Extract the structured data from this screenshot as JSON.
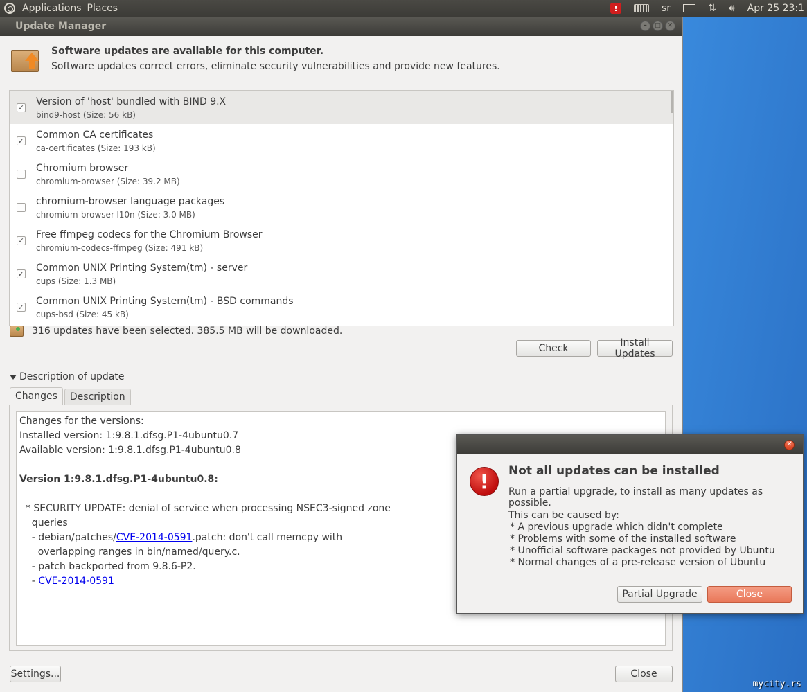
{
  "top_panel": {
    "menus": [
      "Applications",
      "Places"
    ],
    "tray": {
      "alert_icon": "alert-icon",
      "keyboard_layout": "sr",
      "datetime": "Apr 25 23:1"
    }
  },
  "window": {
    "title": "Update Manager",
    "header": {
      "title": "Software updates are available for this computer.",
      "subtitle": "Software updates correct errors, eliminate security vulnerabilities and provide new features."
    },
    "packages": [
      {
        "name": "Version of 'host' bundled with BIND 9.X",
        "detail": "bind9-host (Size: 56 kB)",
        "checked": true,
        "selected": true
      },
      {
        "name": "Common CA certificates",
        "detail": "ca-certificates (Size: 193 kB)",
        "checked": true,
        "selected": false
      },
      {
        "name": "Chromium browser",
        "detail": "chromium-browser (Size: 39.2 MB)",
        "checked": false,
        "selected": false
      },
      {
        "name": "chromium-browser language packages",
        "detail": "chromium-browser-l10n (Size: 3.0 MB)",
        "checked": false,
        "selected": false
      },
      {
        "name": "Free ffmpeg codecs for the Chromium Browser",
        "detail": "chromium-codecs-ffmpeg (Size: 491 kB)",
        "checked": true,
        "selected": false
      },
      {
        "name": "Common UNIX Printing System(tm) - server",
        "detail": "cups (Size: 1.3 MB)",
        "checked": true,
        "selected": false
      },
      {
        "name": "Common UNIX Printing System(tm) - BSD commands",
        "detail": "cups-bsd (Size: 45 kB)",
        "checked": true,
        "selected": false
      }
    ],
    "summary": "316 updates have been selected. 385.5 MB will be downloaded.",
    "buttons": {
      "check": "Check",
      "install": "Install Updates",
      "settings": "Settings...",
      "close": "Close"
    },
    "description": {
      "expander_label": "Description of update",
      "tabs": [
        "Changes",
        "Description"
      ],
      "active_tab": "Changes",
      "changes": {
        "line1": "Changes for the versions:",
        "line2": "Installed version: 1:9.8.1.dfsg.P1-4ubuntu0.7",
        "line3": "Available version: 1:9.8.1.dfsg.P1-4ubuntu0.8",
        "version_heading": "Version 1:9.8.1.dfsg.P1-4ubuntu0.8:",
        "security_line1": "  * SECURITY UPDATE: denial of service when processing NSEC3-signed zone",
        "security_line2": "    queries",
        "patch_prefix": "    - debian/patches/",
        "cve_link": "CVE-2014-0591",
        "patch_suffix": ".patch: don't call memcpy with",
        "patch_line2": "      overlapping ranges in bin/named/query.c.",
        "backport_line": "    - patch backported from 9.8.6-P2.",
        "cve_prefix": "    - ",
        "cve_link2": "CVE-2014-0591"
      }
    }
  },
  "dialog": {
    "title": "Not all updates can be installed",
    "message": "Run a partial upgrade, to install as many updates as possible.",
    "cause_heading": "This can be caused by:",
    "causes": [
      " * A previous upgrade which didn't complete",
      " * Problems with some of the installed software",
      " * Unofficial software packages not provided by Ubuntu",
      " * Normal changes of a pre-release version of Ubuntu"
    ],
    "buttons": {
      "partial": "Partial Upgrade",
      "close": "Close"
    },
    "colors": {
      "primary_button": "#e9785a",
      "error_icon": "#c00e0e"
    }
  },
  "watermark": "mycity.rs"
}
